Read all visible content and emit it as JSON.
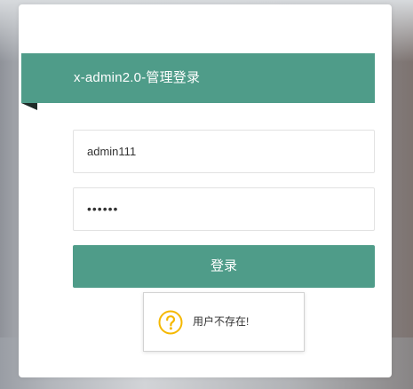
{
  "login": {
    "title": "x-admin2.0-管理登录",
    "username_value": "admin111",
    "password_value": "••••••",
    "submit_label": "登录"
  },
  "toast": {
    "icon": "question-circle-icon",
    "message": "用户不存在!"
  },
  "colors": {
    "accent": "#4f9c89",
    "toast_icon": "#f5b800"
  }
}
